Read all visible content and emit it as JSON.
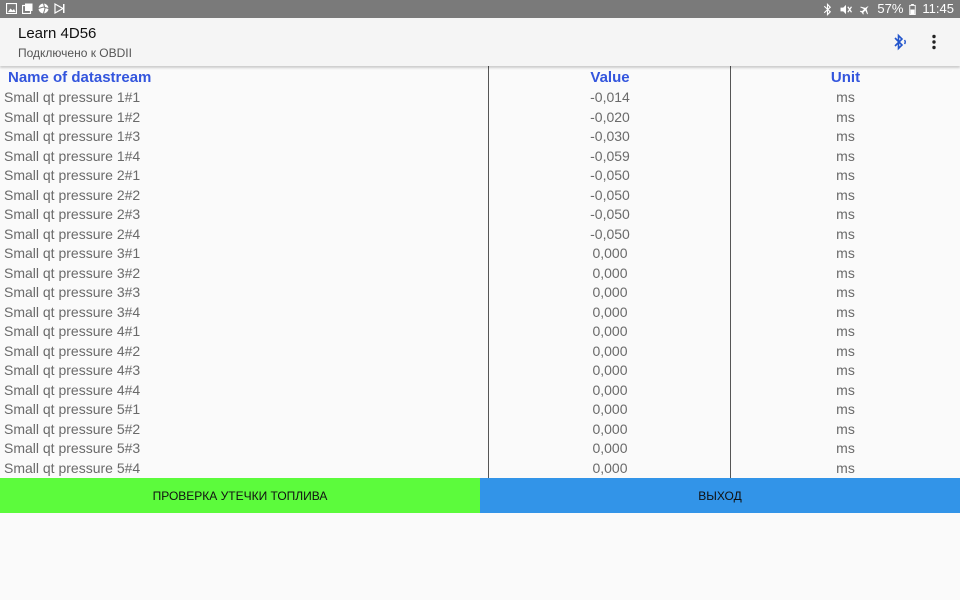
{
  "status_bar": {
    "battery": "57%",
    "time": "11:45",
    "left_icons": [
      "gallery-icon",
      "screenshot-icon",
      "shutter-icon",
      "media-icon"
    ],
    "right_icons": [
      "bluetooth-icon",
      "mute-icon",
      "airplane-icon",
      "battery-icon"
    ]
  },
  "app_bar": {
    "title": "Learn 4D56",
    "subtitle": "Подключено к OBDII",
    "accent": "#3355dd"
  },
  "table": {
    "headers": {
      "name": "Name of datastream",
      "value": "Value",
      "unit": "Unit"
    },
    "header_color": "#3355dd",
    "rows": [
      {
        "name": "Small qt pressure 1#1",
        "value": "-0,014",
        "unit": "ms"
      },
      {
        "name": "Small qt pressure 1#2",
        "value": "-0,020",
        "unit": "ms"
      },
      {
        "name": "Small qt pressure 1#3",
        "value": "-0,030",
        "unit": "ms"
      },
      {
        "name": "Small qt pressure 1#4",
        "value": "-0,059",
        "unit": "ms"
      },
      {
        "name": "Small qt pressure 2#1",
        "value": "-0,050",
        "unit": "ms"
      },
      {
        "name": "Small qt pressure 2#2",
        "value": "-0,050",
        "unit": "ms"
      },
      {
        "name": "Small qt pressure 2#3",
        "value": "-0,050",
        "unit": "ms"
      },
      {
        "name": "Small qt pressure 2#4",
        "value": "-0,050",
        "unit": "ms"
      },
      {
        "name": "Small qt pressure 3#1",
        "value": "0,000",
        "unit": "ms"
      },
      {
        "name": "Small qt pressure 3#2",
        "value": "0,000",
        "unit": "ms"
      },
      {
        "name": "Small qt pressure 3#3",
        "value": "0,000",
        "unit": "ms"
      },
      {
        "name": "Small qt pressure 3#4",
        "value": "0,000",
        "unit": "ms"
      },
      {
        "name": "Small qt pressure 4#1",
        "value": "0,000",
        "unit": "ms"
      },
      {
        "name": "Small qt pressure 4#2",
        "value": "0,000",
        "unit": "ms"
      },
      {
        "name": "Small qt pressure 4#3",
        "value": "0,000",
        "unit": "ms"
      },
      {
        "name": "Small qt pressure 4#4",
        "value": "0,000",
        "unit": "ms"
      },
      {
        "name": "Small qt pressure 5#1",
        "value": "0,000",
        "unit": "ms"
      },
      {
        "name": "Small qt pressure 5#2",
        "value": "0,000",
        "unit": "ms"
      },
      {
        "name": "Small qt pressure 5#3",
        "value": "0,000",
        "unit": "ms"
      },
      {
        "name": "Small qt pressure 5#4",
        "value": "0,000",
        "unit": "ms"
      }
    ]
  },
  "buttons": {
    "check_label": "ПРОВЕРКА УТЕЧКИ ТОПЛИВА",
    "check_color": "#5cfb3c",
    "exit_label": "ВЫХОД",
    "exit_color": "#3294e8"
  }
}
